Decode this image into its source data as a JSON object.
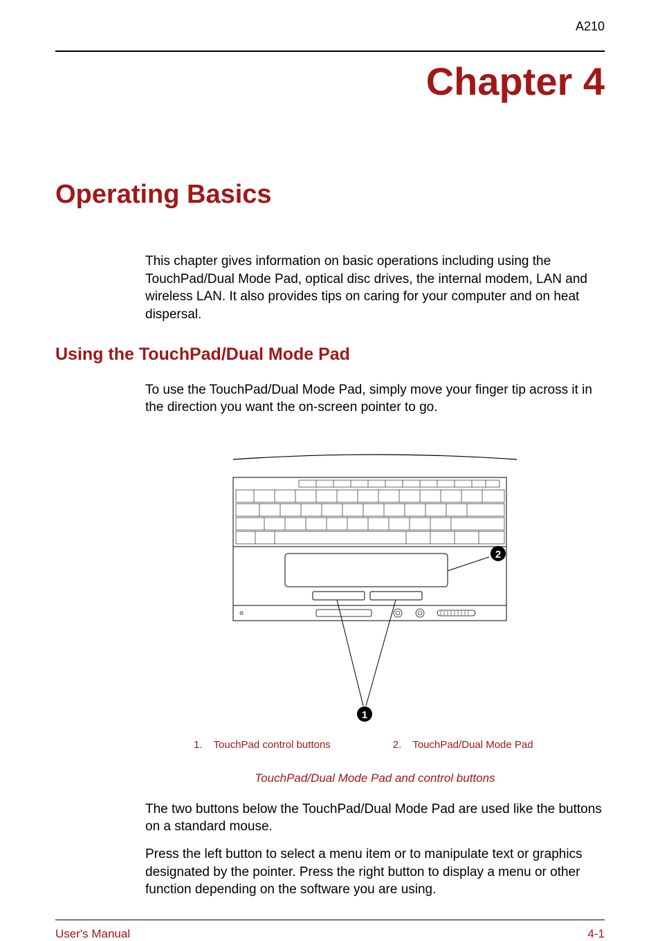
{
  "header": {
    "model": "A210"
  },
  "chapter": {
    "title": "Chapter 4"
  },
  "section": {
    "title": "Operating Basics",
    "intro": "This chapter gives information on basic operations including using the TouchPad/Dual Mode Pad, optical disc drives, the internal modem, LAN and wireless LAN. It also provides tips on caring for your computer and on heat dispersal."
  },
  "subsection": {
    "title": "Using the TouchPad/Dual Mode Pad",
    "para1": "To use the TouchPad/Dual Mode Pad, simply move your finger tip across it in the direction you want the on-screen pointer to go.",
    "legend": [
      {
        "num": "1.",
        "text": "TouchPad control buttons"
      },
      {
        "num": "2.",
        "text": "TouchPad/Dual Mode Pad"
      }
    ],
    "caption": "TouchPad/Dual Mode Pad and control buttons",
    "para2": "The two buttons below the TouchPad/Dual Mode Pad are used like the buttons on a standard mouse.",
    "para3": "Press the left button to select a menu item or to manipulate text or graphics designated by the pointer. Press the right button to display a menu or other function depending on the software you are using."
  },
  "footer": {
    "left": "User's Manual",
    "right": "4-1"
  },
  "callouts": {
    "one": "1",
    "two": "2"
  }
}
